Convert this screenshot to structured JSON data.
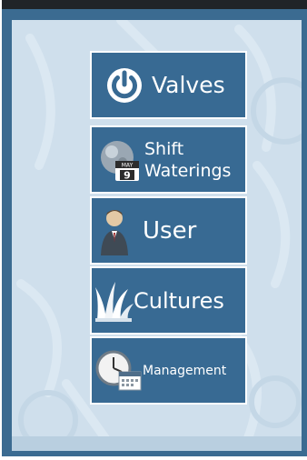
{
  "menu": {
    "valves": {
      "label": "Valves",
      "icon": "power-icon"
    },
    "shift_waterings": {
      "line1": "Shift",
      "line2": "Waterings",
      "icon": "calendar-globe-icon",
      "calendar_month": "MAY",
      "calendar_day": "9"
    },
    "user": {
      "label": "User",
      "icon": "user-icon"
    },
    "cultures": {
      "label": "Cultures",
      "icon": "grass-icon"
    },
    "management": {
      "label": "Management",
      "icon": "clock-calendar-icon"
    }
  },
  "colors": {
    "frame": "#3b6b91",
    "panel": "#cfdfec",
    "button": "#386a93",
    "button_border": "#ffffff",
    "text": "#ffffff"
  }
}
